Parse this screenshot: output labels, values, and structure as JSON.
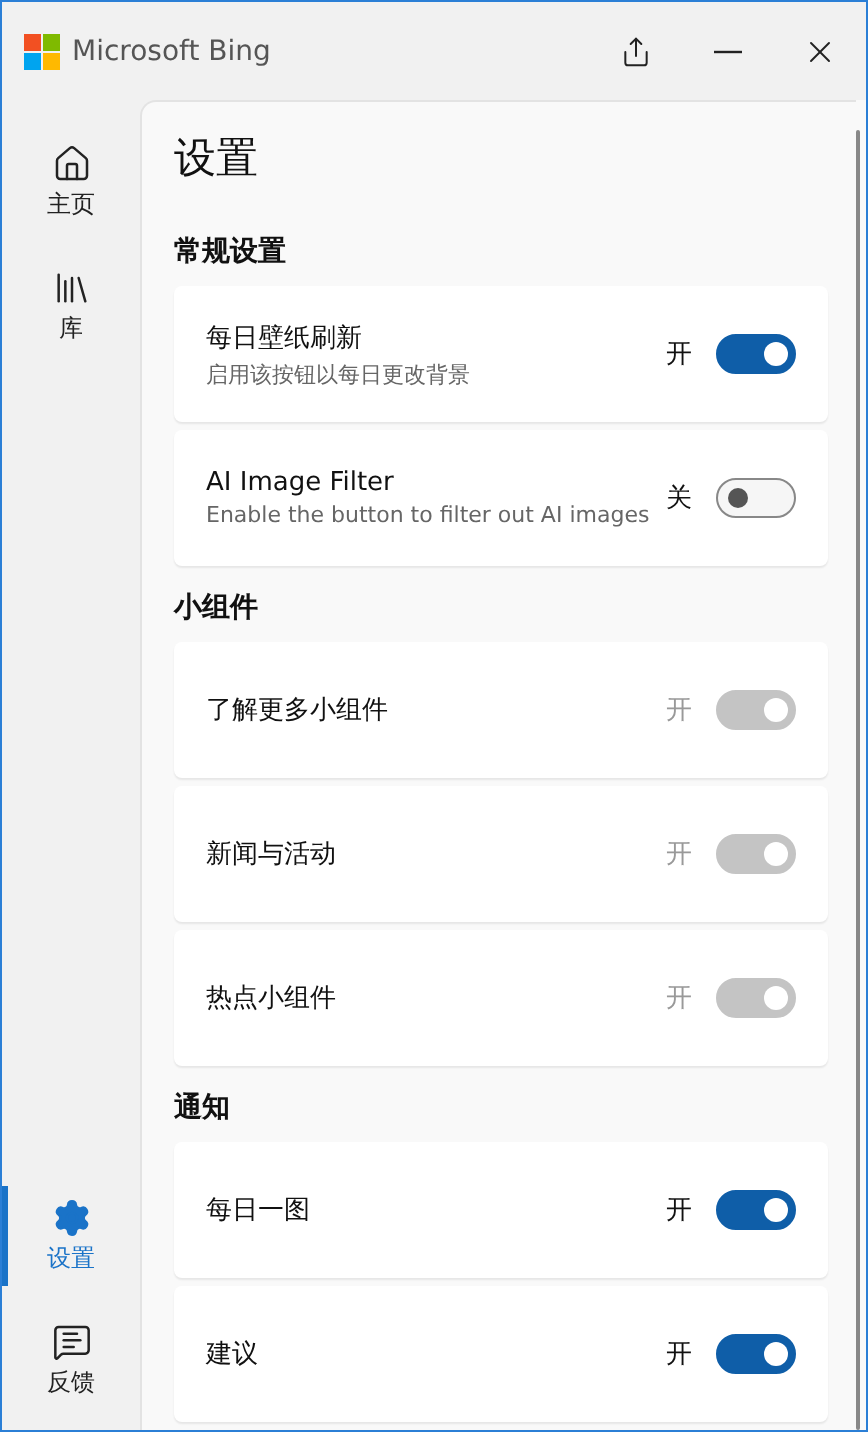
{
  "window": {
    "title": "Microsoft Bing"
  },
  "nav": [
    {
      "label": "主页",
      "selected": false
    },
    {
      "label": "库",
      "selected": false
    },
    {
      "label": "设置",
      "selected": true
    },
    {
      "label": "反馈",
      "selected": false
    }
  ],
  "page_title": "设置",
  "sections": [
    {
      "title": "常规设置",
      "items": [
        {
          "title": "每日壁纸刷新",
          "description": "启用该按钮以每日更改背景",
          "state_label": "开",
          "on": true,
          "disabled": false
        },
        {
          "title": "AI Image Filter",
          "description": "Enable the button to filter out AI images",
          "state_label": "关",
          "on": false,
          "disabled": false
        }
      ]
    },
    {
      "title": "小组件",
      "items": [
        {
          "title": "了解更多小组件",
          "state_label": "开",
          "on": true,
          "disabled": true
        },
        {
          "title": "新闻与活动",
          "state_label": "开",
          "on": true,
          "disabled": true
        },
        {
          "title": "热点小组件",
          "state_label": "开",
          "on": true,
          "disabled": true
        }
      ]
    },
    {
      "title": "通知",
      "items": [
        {
          "title": "每日一图",
          "state_label": "开",
          "on": true,
          "disabled": false
        },
        {
          "title": "建议",
          "state_label": "开",
          "on": true,
          "disabled": false
        }
      ]
    }
  ]
}
